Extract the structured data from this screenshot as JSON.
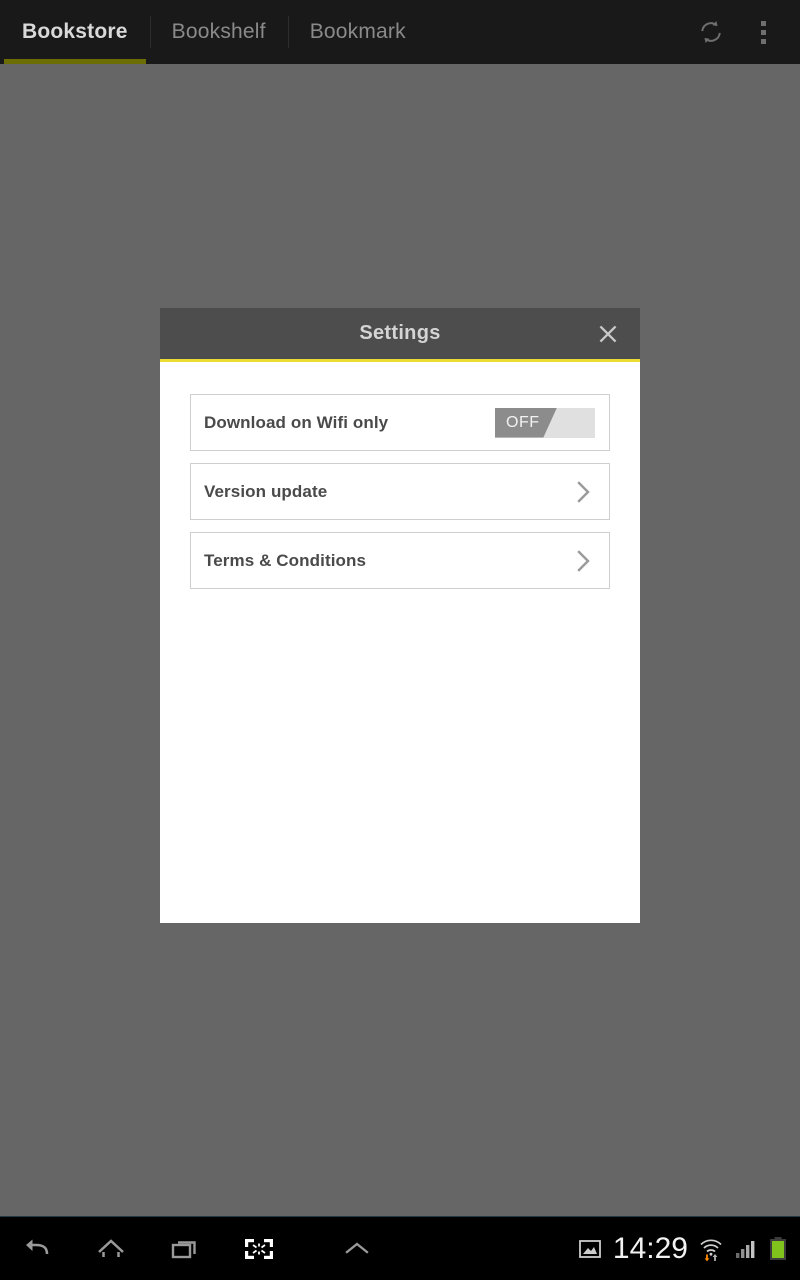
{
  "appbar": {
    "tabs": [
      {
        "label": "Bookstore",
        "active": true
      },
      {
        "label": "Bookshelf",
        "active": false
      },
      {
        "label": "Bookmark",
        "active": false
      }
    ],
    "refresh_icon": "refresh-icon",
    "overflow_icon": "more-vertical-icon",
    "background": "#191919",
    "active_underline": "#6d6d06"
  },
  "dialog": {
    "title": "Settings",
    "close_icon": "close-icon",
    "header_bg": "#4d4d4d",
    "accent": "#ebdb33",
    "body_bg": "#ffffff",
    "rows": [
      {
        "label": "Download on Wifi only",
        "control": "toggle",
        "toggle_value": "OFF",
        "toggle_state": "off"
      },
      {
        "label": "Version update",
        "control": "chevron",
        "chevron_icon": "chevron-right-icon"
      },
      {
        "label": "Terms & Conditions",
        "control": "chevron",
        "chevron_icon": "chevron-right-icon"
      }
    ]
  },
  "scrim": {
    "color": "#666666"
  },
  "navbar": {
    "buttons": [
      {
        "name": "back-button",
        "icon": "back-arrow-icon"
      },
      {
        "name": "home-button",
        "icon": "home-icon"
      },
      {
        "name": "recents-button",
        "icon": "recent-apps-icon"
      },
      {
        "name": "screenshot-button",
        "icon": "screenshot-capture-icon"
      },
      {
        "name": "expand-button",
        "icon": "chevron-up-icon"
      }
    ],
    "status": {
      "gallery_icon": "image-icon",
      "time": "14:29",
      "wifi_icon": "wifi-transfer-icon",
      "signal_icon": "cellular-signal-icon",
      "battery_icon": "battery-full-icon",
      "battery_color": "#7fc31c",
      "wifi_down_color": "#ff8c00"
    }
  }
}
